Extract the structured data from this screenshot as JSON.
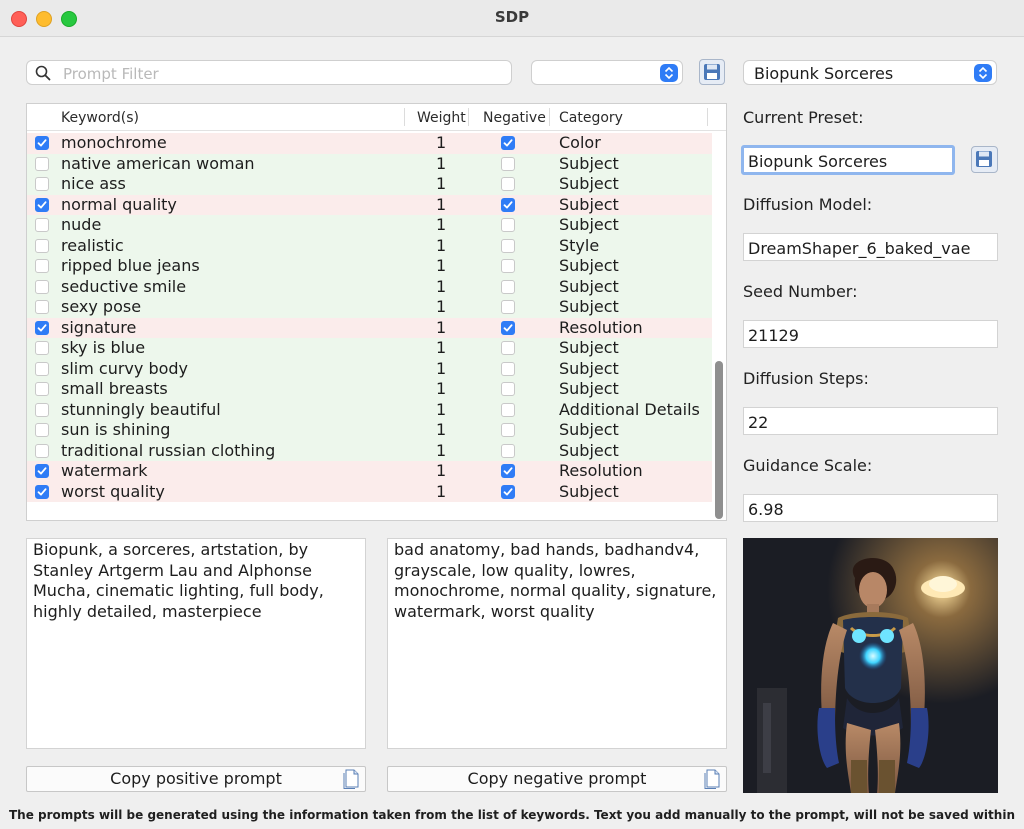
{
  "window": {
    "title": "SDP"
  },
  "search": {
    "placeholder": "Prompt Filter",
    "value": ""
  },
  "category_filter": {
    "value": ""
  },
  "preset_select": {
    "value": "Biopunk Sorceres"
  },
  "table": {
    "headers": [
      "Keyword(s)",
      "Weight",
      "Negative",
      "Category"
    ],
    "rows": [
      {
        "checked": true,
        "keyword": "monochrome",
        "weight": "1",
        "negative": true,
        "category": "Color"
      },
      {
        "checked": false,
        "keyword": "native american woman",
        "weight": "1",
        "negative": false,
        "category": "Subject"
      },
      {
        "checked": false,
        "keyword": "nice ass",
        "weight": "1",
        "negative": false,
        "category": "Subject"
      },
      {
        "checked": true,
        "keyword": "normal quality",
        "weight": "1",
        "negative": true,
        "category": "Subject"
      },
      {
        "checked": false,
        "keyword": "nude",
        "weight": "1",
        "negative": false,
        "category": "Subject"
      },
      {
        "checked": false,
        "keyword": "realistic",
        "weight": "1",
        "negative": false,
        "category": "Style"
      },
      {
        "checked": false,
        "keyword": "ripped blue jeans",
        "weight": "1",
        "negative": false,
        "category": "Subject"
      },
      {
        "checked": false,
        "keyword": "seductive smile",
        "weight": "1",
        "negative": false,
        "category": "Subject"
      },
      {
        "checked": false,
        "keyword": "sexy pose",
        "weight": "1",
        "negative": false,
        "category": "Subject"
      },
      {
        "checked": true,
        "keyword": "signature",
        "weight": "1",
        "negative": true,
        "category": "Resolution"
      },
      {
        "checked": false,
        "keyword": "sky is blue",
        "weight": "1",
        "negative": false,
        "category": "Subject"
      },
      {
        "checked": false,
        "keyword": "slim curvy body",
        "weight": "1",
        "negative": false,
        "category": "Subject"
      },
      {
        "checked": false,
        "keyword": "small breasts",
        "weight": "1",
        "negative": false,
        "category": "Subject"
      },
      {
        "checked": false,
        "keyword": "stunningly beautiful",
        "weight": "1",
        "negative": false,
        "category": "Additional Details"
      },
      {
        "checked": false,
        "keyword": "sun is shining",
        "weight": "1",
        "negative": false,
        "category": "Subject"
      },
      {
        "checked": false,
        "keyword": "traditional russian clothing",
        "weight": "1",
        "negative": false,
        "category": "Subject"
      },
      {
        "checked": true,
        "keyword": "watermark",
        "weight": "1",
        "negative": true,
        "category": "Resolution"
      },
      {
        "checked": true,
        "keyword": "worst quality",
        "weight": "1",
        "negative": true,
        "category": "Subject"
      }
    ]
  },
  "settings": {
    "current_preset_label": "Current Preset:",
    "current_preset_value": "Biopunk Sorceres",
    "model_label": "Diffusion Model:",
    "model_value": "DreamShaper_6_baked_vae",
    "seed_label": "Seed Number:",
    "seed_value": "21129",
    "steps_label": "Diffusion Steps:",
    "steps_value": "22",
    "guidance_label": "Guidance Scale:",
    "guidance_value": "6.98"
  },
  "prompts": {
    "positive": "Biopunk, a sorceres, artstation, by Stanley Artgerm Lau and Alphonse Mucha, cinematic lighting, full body, highly detailed, masterpiece",
    "negative": "bad anatomy, bad hands, badhandv4, grayscale, low quality, lowres, monochrome, normal quality, signature, watermark, worst quality",
    "copy_positive_label": "Copy positive prompt",
    "copy_negative_label": "Copy negative prompt"
  },
  "footer": {
    "text": "The prompts will be generated using the information taken from the list of keywords. Text you add manually to the prompt, will not be saved within"
  },
  "colors": {
    "accent": "#2f7cf6",
    "row_positive": "#edf7ec",
    "row_negative": "#fbeceb"
  }
}
